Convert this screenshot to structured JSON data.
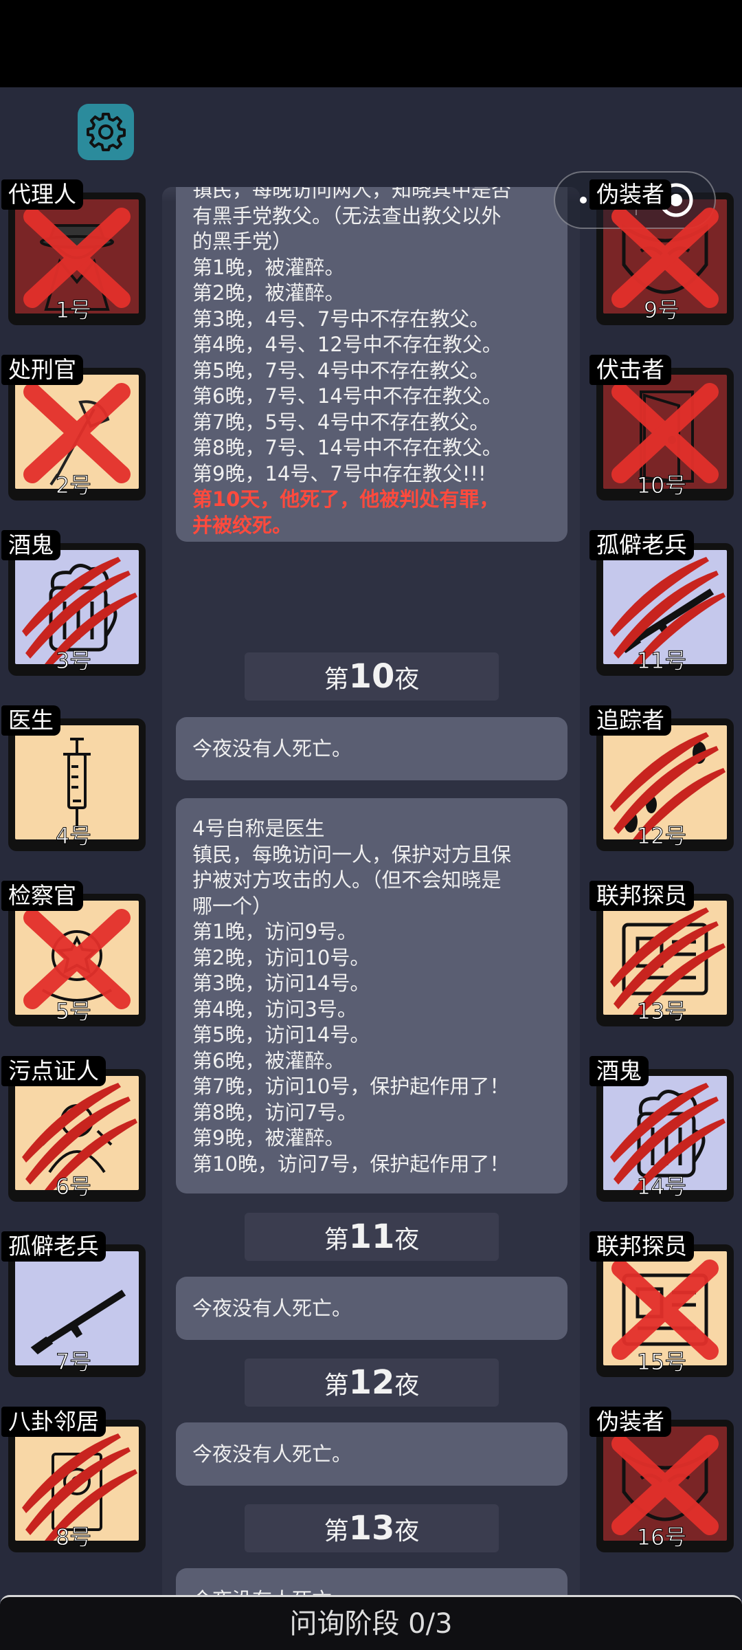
{
  "app": {
    "settings_icon": "gear-icon",
    "capsule": {
      "more_icon": "more-dots-icon",
      "close_icon": "target-close-icon"
    }
  },
  "players_left": [
    {
      "name": "代理人",
      "number": "1号",
      "bg": "maroon",
      "icon": "detective-icon",
      "mark": "x"
    },
    {
      "name": "处刑官",
      "number": "2号",
      "bg": "peach",
      "icon": "axe-icon",
      "mark": "x"
    },
    {
      "name": "酒鬼",
      "number": "3号",
      "bg": "lav",
      "icon": "beer-icon",
      "mark": "claw"
    },
    {
      "name": "医生",
      "number": "4号",
      "bg": "peach",
      "icon": "syringe-icon",
      "mark": "none"
    },
    {
      "name": "检察官",
      "number": "5号",
      "bg": "peach",
      "icon": "badge-icon",
      "mark": "x"
    },
    {
      "name": "污点证人",
      "number": "6号",
      "bg": "peach",
      "icon": "witness-icon",
      "mark": "claw"
    },
    {
      "name": "孤僻老兵",
      "number": "7号",
      "bg": "lav",
      "icon": "rifle-icon",
      "mark": "none"
    },
    {
      "name": "八卦邻居",
      "number": "8号",
      "bg": "peach",
      "icon": "neighbor-icon",
      "mark": "claw"
    }
  ],
  "players_right": [
    {
      "name": "伪装者",
      "number": "9号",
      "bg": "maroon",
      "icon": "mask-icon",
      "mark": "x"
    },
    {
      "name": "伏击者",
      "number": "10号",
      "bg": "maroon",
      "icon": "door-icon",
      "mark": "x"
    },
    {
      "name": "孤僻老兵",
      "number": "11号",
      "bg": "lav",
      "icon": "rifle-icon",
      "mark": "claw"
    },
    {
      "name": "追踪者",
      "number": "12号",
      "bg": "peach",
      "icon": "footprints-icon",
      "mark": "claw"
    },
    {
      "name": "联邦探员",
      "number": "13号",
      "bg": "peach",
      "icon": "id-card-icon",
      "mark": "claw"
    },
    {
      "name": "酒鬼",
      "number": "14号",
      "bg": "lav",
      "icon": "beer-icon",
      "mark": "claw"
    },
    {
      "name": "联邦探员",
      "number": "15号",
      "bg": "peach",
      "icon": "id-card-icon",
      "mark": "x"
    },
    {
      "name": "伪装者",
      "number": "16号",
      "bg": "maroon",
      "icon": "mask-icon",
      "mark": "x"
    }
  ],
  "log": {
    "entry1": {
      "lines": [
        "镇民，每晚访问两人，知晓其中是否",
        "有黑手党教父。（无法查出教父以外",
        "的黑手党）",
        "第1晚，被灌醉。",
        "第2晚，被灌醉。",
        "第3晚，4号、7号中不存在教父。",
        "第4晚，4号、12号中不存在教父。",
        "第5晚，7号、4号中不存在教父。",
        "第6晚，7号、14号中不存在教父。",
        "第7晚，5号、4号中不存在教父。",
        "第8晚，7号、14号中不存在教父。",
        "第9晚，14号、7号中存在教父!!!"
      ],
      "red_lines": [
        "第10天，他死了，他被判处有罪，",
        "并被绞死。"
      ]
    },
    "night10": {
      "prefix": "第",
      "num": "10",
      "suffix": "夜"
    },
    "night10_text": "今夜没有人死亡。",
    "entry2": {
      "lines": [
        "4号自称是医生",
        "镇民，每晚访问一人，保护对方且保",
        "护被对方攻击的人。（但不会知晓是",
        "哪一个）",
        "第1晚，访问9号。",
        "第2晚，访问10号。",
        "第3晚，访问14号。",
        "第4晚，访问3号。",
        "第5晚，访问14号。",
        "第6晚，被灌醉。",
        "第7晚，访问10号，保护起作用了！",
        "第8晚，访问7号。",
        "第9晚，被灌醉。",
        "第10晚，访问7号，保护起作用了！"
      ]
    },
    "night11": {
      "prefix": "第",
      "num": "11",
      "suffix": "夜"
    },
    "night11_text": "今夜没有人死亡。",
    "night12": {
      "prefix": "第",
      "num": "12",
      "suffix": "夜"
    },
    "night12_text": "今夜没有人死亡。",
    "night13": {
      "prefix": "第",
      "num": "13",
      "suffix": "夜"
    },
    "night13_text": "今夜没有人死亡。"
  },
  "phase": {
    "label": "问询阶段 0/3"
  },
  "colors": {
    "peach": "#f8d7a6",
    "lavender": "#c5c8ec",
    "maroon": "#7a2526",
    "panel": "#2e3142",
    "entry": "#5a5e72",
    "accent_red": "#ff4a3d",
    "settings": "#2b8b9c"
  }
}
